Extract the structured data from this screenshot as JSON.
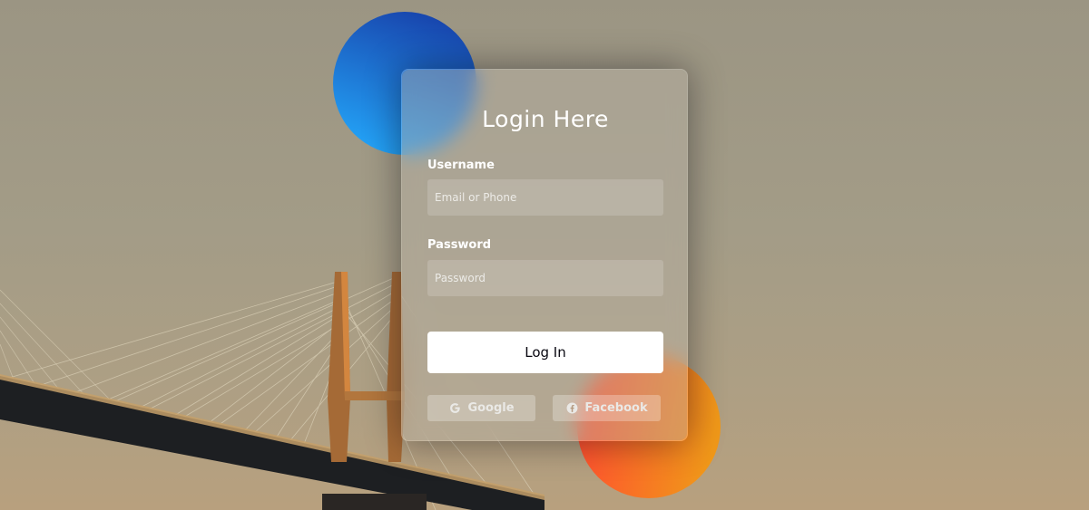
{
  "login": {
    "title": "Login Here",
    "username_label": "Username",
    "username_placeholder": "Email or Phone",
    "password_label": "Password",
    "password_placeholder": "Password",
    "submit_label": "Log In"
  },
  "social": {
    "google": {
      "label": "Google",
      "icon": "google-icon"
    },
    "facebook": {
      "label": "Facebook",
      "icon": "facebook-icon"
    }
  },
  "colors": {
    "blue_circle_start": "#1845ad",
    "blue_circle_end": "#23a2f6",
    "orange_circle_start": "#ff512f",
    "orange_circle_end": "#f09819",
    "button_background": "#ffffff",
    "button_text": "#080710"
  }
}
